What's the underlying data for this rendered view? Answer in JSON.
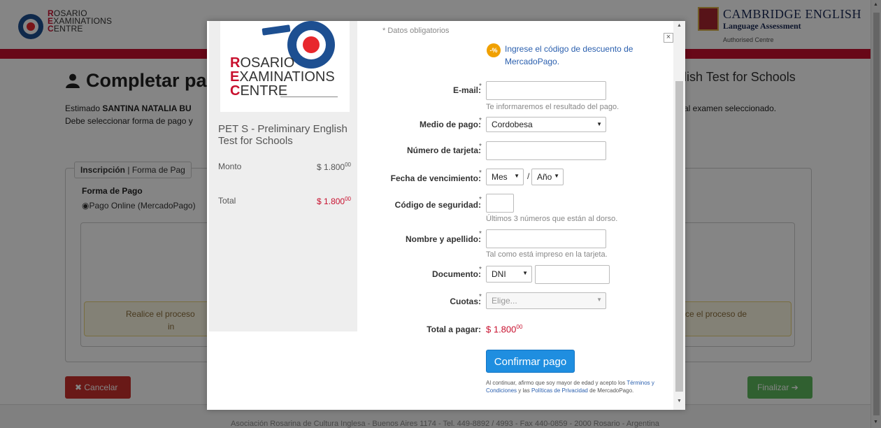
{
  "header": {
    "logo": {
      "line1_initial": "R",
      "line1_rest": "OSARIO",
      "line2_initial": "E",
      "line2_rest": "XAMINATIONS",
      "line3_initial": "C",
      "line3_rest": "ENTRE"
    },
    "cambridge": {
      "title": "CAMBRIDGE ENGLISH",
      "subtitle": "Language Assessment",
      "tagline": "Authorised Centre"
    }
  },
  "background": {
    "title": "Completar pago",
    "title_right": "glish Test for Schools",
    "greeting_prefix": "Estimado ",
    "greeting_name": "SANTINA NATALIA BU",
    "greeting_line2": "Debe seleccionar forma de pago y",
    "greeting_right": "e al examen seleccionado.",
    "tab_active": "Inscripción",
    "tab_sep": " | ",
    "tab_other": "Forma de Pag",
    "forma_de_pago": "Forma de Pago",
    "radio_label": "Pago Online (MercadoPago)",
    "warn_left": "Realice el proceso",
    "warn_left2": "in",
    "warn_right": "alice el proceso de",
    "cancel_label": "Cancelar",
    "finish_label": "Finalizar",
    "footer": "Asociación Rosarina de Cultura Inglesa - Buenos Aires 1174 - Tel. 449-8892 / 4993 - Fax 440-0859 - 2000 Rosario - Argentina"
  },
  "modal": {
    "logo": {
      "line1_initial": "R",
      "line1_rest": "OSARIO",
      "line2_initial": "E",
      "line2_rest": "XAMINATIONS",
      "line3_initial": "C",
      "line3_rest": "ENTRE"
    },
    "product": "PET S - Preliminary English Test for Schools",
    "monto_label": "Monto",
    "monto_value": "$ 1.800",
    "monto_cents": "00",
    "total_label": "Total",
    "total_value": "$ 1.800",
    "total_cents": "00",
    "required_note": "* Datos obligatorios",
    "discount_icon_text": "-%",
    "discount_link": "Ingrese el código de descuento de MercadoPago.",
    "required_mark": "*",
    "fields": {
      "email_label": "E-mail:",
      "email_help": "Te informaremos el resultado del pago.",
      "medio_label": "Medio de pago:",
      "medio_value": "Cordobesa",
      "tarjeta_label": "Número de tarjeta:",
      "vencimiento_label": "Fecha de vencimiento:",
      "mes_value": "Mes",
      "slash": "/",
      "anio_value": "Año",
      "seguridad_label": "Código de seguridad:",
      "seguridad_help": "Últimos 3 números que están al dorso.",
      "nombre_label": "Nombre y apellido:",
      "nombre_help": "Tal como está impreso en la tarjeta.",
      "documento_label": "Documento:",
      "documento_value": "DNI",
      "cuotas_label": "Cuotas:",
      "cuotas_placeholder": "Elige...",
      "total_label": "Total a pagar:",
      "total_value": "$ 1.800",
      "total_cents": "00"
    },
    "confirm_label": "Confirmar pago",
    "legal_pre": "Al continuar, afirmo que soy mayor de edad y acepto los ",
    "legal_terms": "Términos y Condiciones",
    "legal_mid": " y las ",
    "legal_privacy": "Políticas de Privacidad",
    "legal_post": " de MercadoPago.",
    "close_label": "×"
  },
  "colors": {
    "brand_red": "#c8102e",
    "button_blue": "#1f8ee0",
    "link_blue": "#2a5fae",
    "success_green": "#5cb85c",
    "danger_red": "#c9302c"
  }
}
